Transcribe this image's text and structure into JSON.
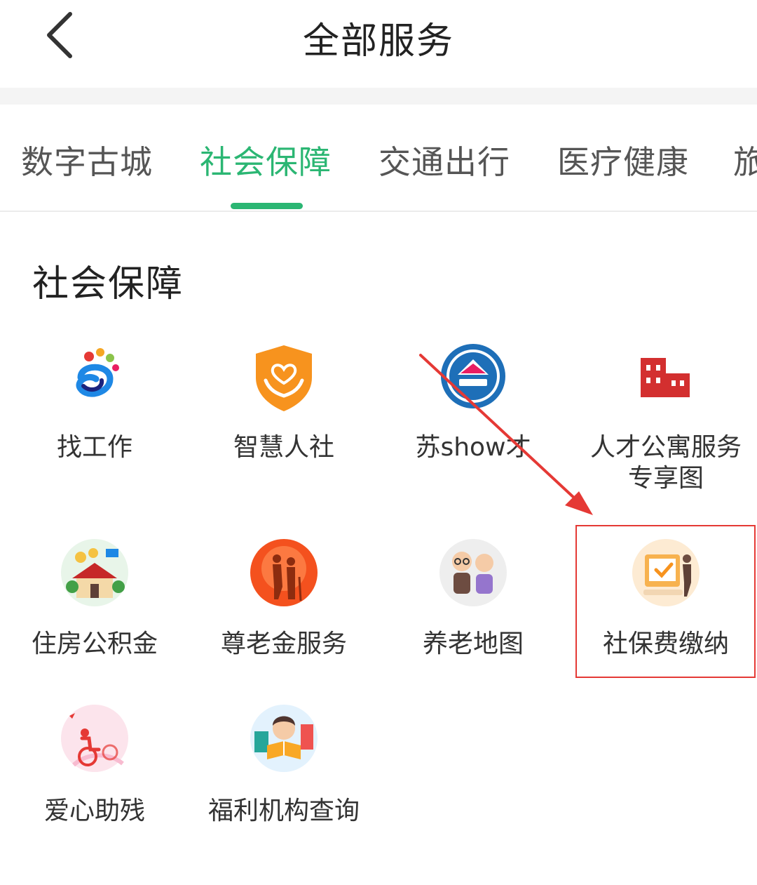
{
  "header": {
    "title": "全部服务"
  },
  "tabs": [
    {
      "label": "数字古城",
      "active": false
    },
    {
      "label": "社会保障",
      "active": true
    },
    {
      "label": "交通出行",
      "active": false
    },
    {
      "label": "医疗健康",
      "active": false
    },
    {
      "label": "旅",
      "active": false
    }
  ],
  "section": {
    "title": "社会保障"
  },
  "items": [
    {
      "label": "找工作",
      "icon": "job-search-logo-icon"
    },
    {
      "label": "智慧人社",
      "icon": "heart-shield-icon"
    },
    {
      "label": "苏show才",
      "icon": "suzhou-talent-badge-icon"
    },
    {
      "label": "人才公寓服务专享图",
      "label_line1": "人才公寓服务",
      "label_line2": "专享图",
      "icon": "red-buildings-icon"
    },
    {
      "label": "住房公积金",
      "icon": "house-fund-icon"
    },
    {
      "label": "尊老金服务",
      "icon": "elderly-couple-icon"
    },
    {
      "label": "养老地图",
      "icon": "elderly-pair-icon"
    },
    {
      "label": "社保费缴纳",
      "icon": "payment-screen-icon"
    },
    {
      "label": "爱心助残",
      "icon": "wheelchair-icon"
    },
    {
      "label": "福利机构查询",
      "icon": "girl-reading-icon"
    }
  ],
  "colors": {
    "accent": "#2bb673",
    "annotation": "#e53935"
  }
}
